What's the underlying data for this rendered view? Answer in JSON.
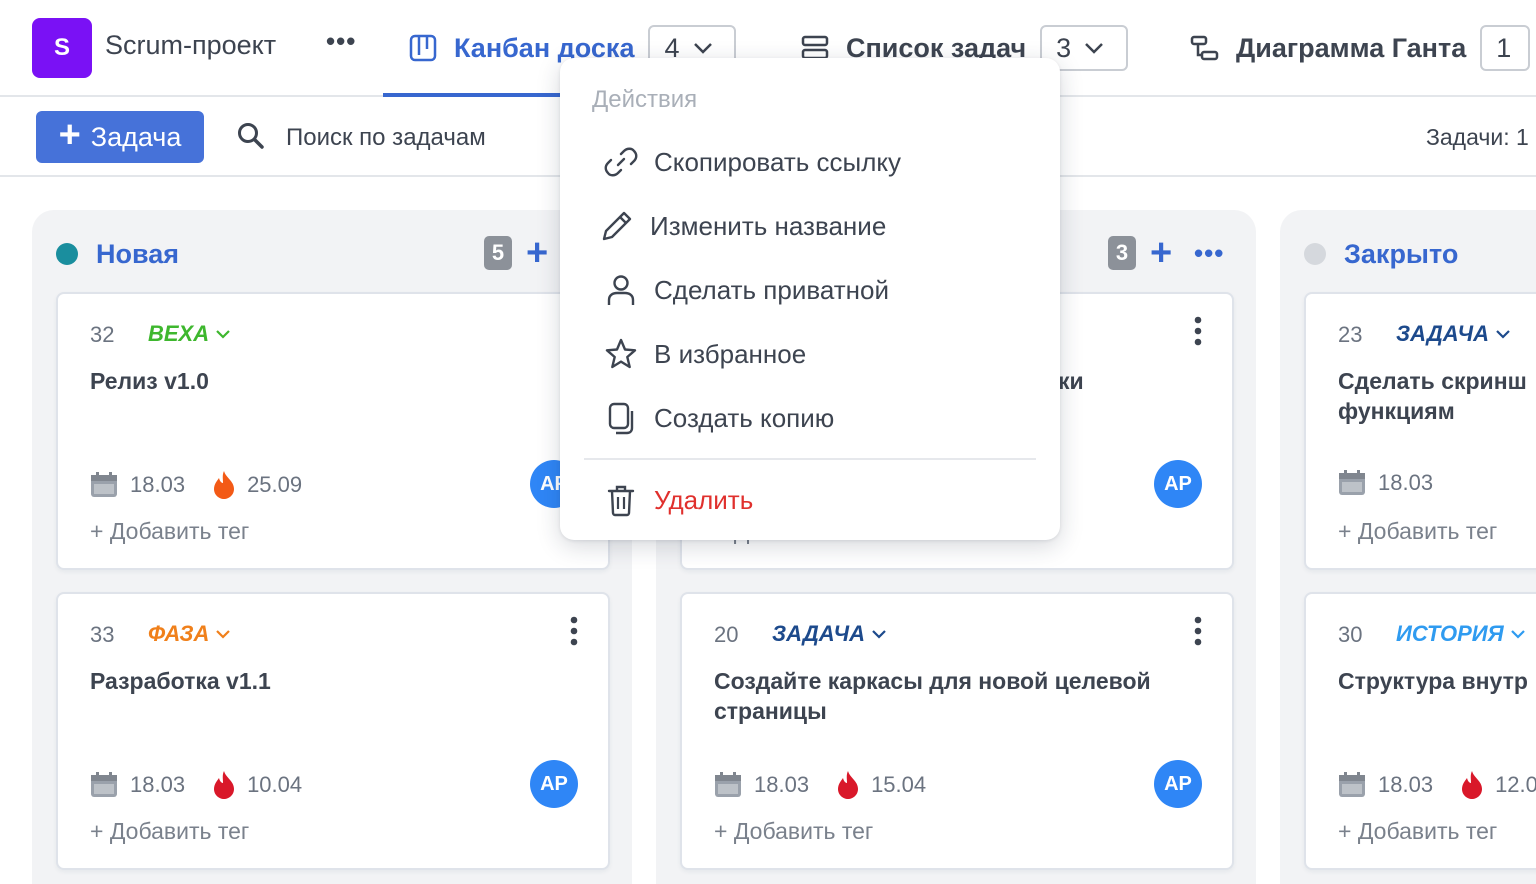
{
  "project": {
    "avatar_letter": "S",
    "name": "Scrum-проект",
    "more": "•••",
    "avatar_color": "#7a11f5"
  },
  "tabs": [
    {
      "label": "Канбан доска",
      "count": "4",
      "icon": "kanban-icon"
    },
    {
      "label": "Список задач",
      "count": "3",
      "icon": "list-icon"
    },
    {
      "label": "Диаграмма Ганта",
      "count": "1",
      "icon": "gantt-icon"
    }
  ],
  "toolbar": {
    "add_label": "Задача",
    "add_plus": "+",
    "search_label": "Поиск по задачам",
    "tasks_count": "Задачи: 1"
  },
  "columns": [
    {
      "title": "Новая",
      "count": "5",
      "plus": "+",
      "dot_color": "#1a8e9e"
    },
    {
      "count": "3",
      "plus": "+",
      "more": "•••"
    },
    {
      "title": "Закрыто",
      "dot_color": "#d5d8dd"
    }
  ],
  "cards": [
    {
      "num": "32",
      "type": "ВЕХА",
      "type_color": "#3eb72e",
      "title": "Релиз v1.0",
      "date": "18.03",
      "due": "25.09",
      "avatar": "AP",
      "add_tag": "+ Добавить тег"
    },
    {
      "num": "33",
      "type": "ФАЗА",
      "type_color": "#f0801b",
      "title": "Разработка v1.1",
      "date": "18.03",
      "due": "10.04",
      "avatar": "AP",
      "add_tag": "+ Добавить тег"
    },
    {
      "title_fragment": "ки",
      "avatar": "AP",
      "add_tag": "+ Добавить тег"
    },
    {
      "num": "20",
      "type": "ЗАДАЧА",
      "type_color": "#1d4a8c",
      "title": "Создайте каркасы для новой целевой страницы",
      "date": "18.03",
      "due": "15.04",
      "avatar": "AP",
      "add_tag": "+ Добавить тег"
    },
    {
      "num": "23",
      "type": "ЗАДАЧА",
      "type_color": "#1d4a8c",
      "title": "Сделать скринш функциям",
      "date": "18.03",
      "add_tag": "+ Добавить тег"
    },
    {
      "num": "30",
      "type": "ИСТОРИЯ",
      "type_color": "#2f9bf0",
      "title": "Структура внутр",
      "date": "18.03",
      "due": "12.0",
      "add_tag": "+ Добавить тег"
    }
  ],
  "menu": {
    "header": "Действия",
    "items": [
      {
        "label": "Скопировать ссылку",
        "icon": "link-icon"
      },
      {
        "label": "Изменить название",
        "icon": "pencil-icon"
      },
      {
        "label": "Сделать приватной",
        "icon": "user-icon"
      },
      {
        "label": "В избранное",
        "icon": "star-icon"
      },
      {
        "label": "Создать копию",
        "icon": "copy-icon"
      },
      {
        "label": "Удалить",
        "icon": "trash-icon",
        "color": "#e0302d"
      }
    ]
  },
  "colors": {
    "accent": "#3767cf",
    "button": "#4672d9",
    "avatar": "#2f86f6",
    "fire_orange": "#f35a16",
    "fire_red": "#d9182a"
  }
}
